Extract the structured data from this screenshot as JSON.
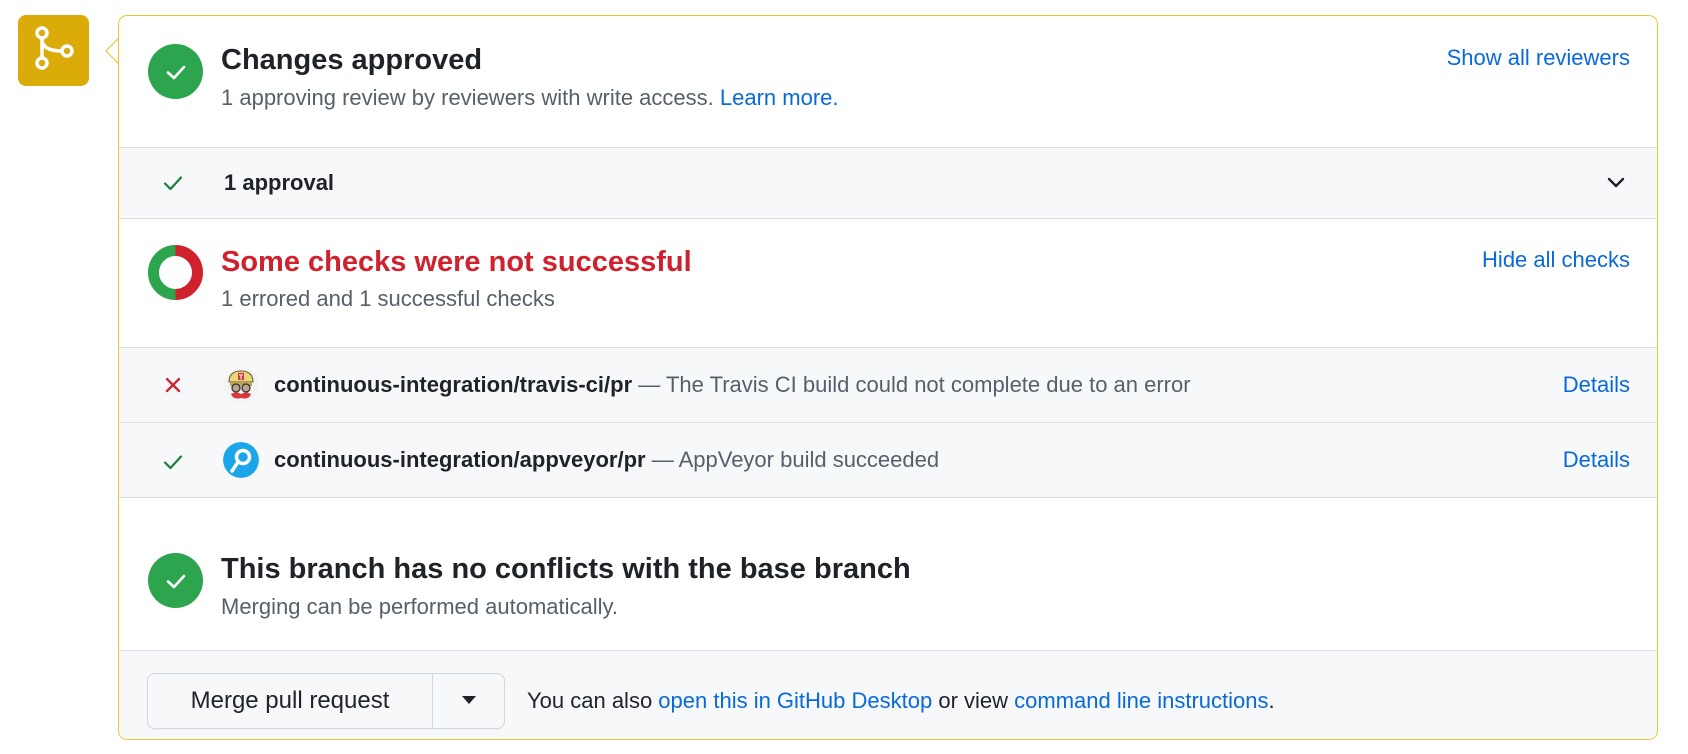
{
  "colors": {
    "accent_yellow": "#dbab0a",
    "border_yellow": "#e8c73a",
    "success_green": "#2da44e",
    "error_red": "#cf222e",
    "link_blue": "#0969da"
  },
  "merge_icon": "git-merge-icon",
  "reviews": {
    "icon": "check-circle-icon",
    "title": "Changes approved",
    "subtitle": "1 approving review by reviewers with write access.",
    "learn_more": "Learn more.",
    "show_all": "Show all reviewers",
    "approval_row": {
      "icon": "check-icon",
      "label": "1 approval",
      "toggle_icon": "chevron-down-icon"
    }
  },
  "checks": {
    "icon": "checks-donut-icon",
    "summary": {
      "errored": 1,
      "successful": 1
    },
    "title": "Some checks were not successful",
    "subtitle": "1 errored and 1 successful checks",
    "hide_all": "Hide all checks",
    "items": [
      {
        "status": "error",
        "status_icon": "x-icon",
        "avatar": "travis-ci-avatar",
        "name": "continuous-integration/travis-ci/pr",
        "separator": " — ",
        "description": "The Travis CI build could not complete due to an error",
        "link": "Details"
      },
      {
        "status": "success",
        "status_icon": "check-icon",
        "avatar": "appveyor-avatar",
        "name": "continuous-integration/appveyor/pr",
        "separator": " — ",
        "description": "AppVeyor build succeeded",
        "link": "Details"
      }
    ]
  },
  "conflicts": {
    "icon": "check-circle-icon",
    "title": "This branch has no conflicts with the base branch",
    "subtitle": "Merging can be performed automatically."
  },
  "footer": {
    "merge_button": "Merge pull request",
    "dropdown_icon": "triangle-down-icon",
    "text_prefix": "You can also ",
    "desktop_link": "open this in GitHub Desktop",
    "text_middle": " or view ",
    "cli_link": "command line instructions",
    "text_suffix": "."
  }
}
